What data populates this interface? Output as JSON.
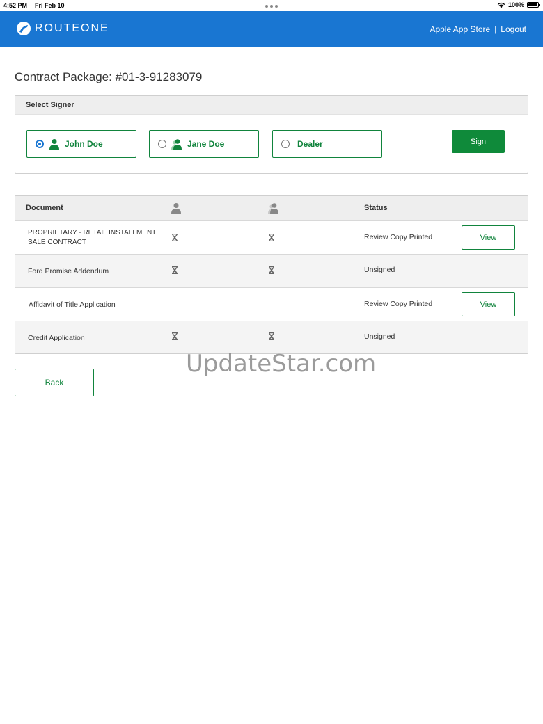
{
  "status_bar": {
    "time": "4:52 PM",
    "date": "Fri Feb 10",
    "battery": "100%"
  },
  "header": {
    "logo_text": "ROUTEONE",
    "links": [
      "Apple App Store",
      "Logout"
    ],
    "separator": "|",
    "bg_color": "#1976d2"
  },
  "page": {
    "title": "Contract Package: #01-3-91283079"
  },
  "signer_panel": {
    "heading": "Select Signer",
    "signers": [
      {
        "label": "John Doe",
        "selected": true,
        "icon": "person-icon"
      },
      {
        "label": "Jane Doe",
        "selected": false,
        "icon": "co-buyer-icon"
      },
      {
        "label": "Dealer",
        "selected": false,
        "icon": null
      }
    ],
    "sign_label": "Sign"
  },
  "documents": {
    "headers": {
      "document": "Document",
      "status": "Status"
    },
    "rows": [
      {
        "name": "PROPRIETARY - RETAIL INSTALLMENT SALE CONTRACT",
        "buyer_pending": true,
        "cobuyer_pending": true,
        "status": "Review Copy Printed",
        "action": "View"
      },
      {
        "name": "Ford Promise Addendum",
        "buyer_pending": true,
        "cobuyer_pending": true,
        "status": "Unsigned",
        "action": null
      },
      {
        "name": "Affidavit of Title Application",
        "buyer_pending": false,
        "cobuyer_pending": false,
        "status": "Review Copy Printed",
        "action": "View"
      },
      {
        "name": "Credit Application",
        "buyer_pending": true,
        "cobuyer_pending": true,
        "status": "Unsigned",
        "action": null
      }
    ]
  },
  "back_label": "Back",
  "watermark": "UpdateStar.com",
  "colors": {
    "accent_green": "#11843d",
    "sign_green": "#0f8a3a",
    "header_blue": "#1976d2"
  }
}
